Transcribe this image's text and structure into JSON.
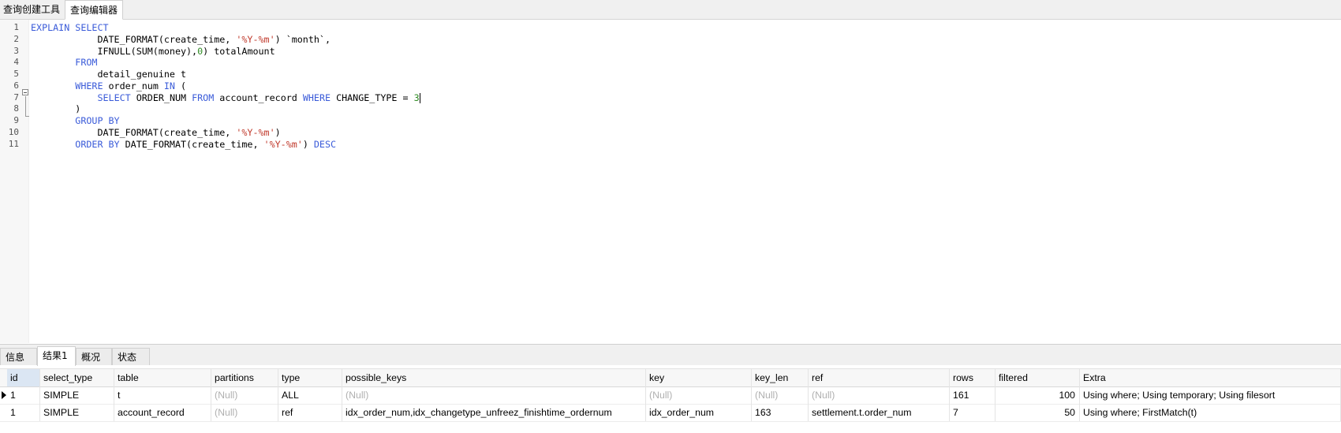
{
  "top_tabs": [
    "查询创建工具",
    "查询编辑器"
  ],
  "editor": {
    "line_numbers": [
      "1",
      "2",
      "3",
      "4",
      "5",
      "6",
      "7",
      "8",
      "9",
      "10",
      "11"
    ],
    "lines": [
      [
        [
          "kw",
          "EXPLAIN SELECT"
        ]
      ],
      [
        [
          "",
          "            DATE_FORMAT(create_time, "
        ],
        [
          "str",
          "'%Y-%m'"
        ],
        [
          "",
          ") `month`,"
        ]
      ],
      [
        [
          "",
          "            IFNULL(SUM(money),"
        ],
        [
          "num",
          "0"
        ],
        [
          "",
          ") totalAmount"
        ]
      ],
      [
        [
          "",
          "        "
        ],
        [
          "kw",
          "FROM"
        ]
      ],
      [
        [
          "",
          "            detail_genuine t"
        ]
      ],
      [
        [
          "",
          "        "
        ],
        [
          "kw",
          "WHERE"
        ],
        [
          "",
          " order_num "
        ],
        [
          "kw",
          "IN"
        ],
        [
          "",
          " ("
        ]
      ],
      [
        [
          "",
          "            "
        ],
        [
          "kw",
          "SELECT"
        ],
        [
          "",
          " ORDER_NUM "
        ],
        [
          "kw",
          "FROM"
        ],
        [
          "",
          " account_record "
        ],
        [
          "kw",
          "WHERE"
        ],
        [
          "",
          " CHANGE_TYPE = "
        ],
        [
          "num",
          "3"
        ]
      ],
      [
        [
          "",
          "        )"
        ]
      ],
      [
        [
          "",
          "        "
        ],
        [
          "kw",
          "GROUP BY"
        ]
      ],
      [
        [
          "",
          "            DATE_FORMAT(create_time, "
        ],
        [
          "str",
          "'%Y-%m'"
        ],
        [
          "",
          ")"
        ]
      ],
      [
        [
          "",
          "        "
        ],
        [
          "kw",
          "ORDER BY"
        ],
        [
          "",
          " DATE_FORMAT(create_time, "
        ],
        [
          "str",
          "'%Y-%m'"
        ],
        [
          "",
          ") "
        ],
        [
          "kw",
          "DESC"
        ]
      ]
    ]
  },
  "bottom_tabs": [
    "信息",
    "结果1",
    "概况",
    "状态"
  ],
  "result": {
    "columns": [
      "id",
      "select_type",
      "table",
      "partitions",
      "type",
      "possible_keys",
      "key",
      "key_len",
      "ref",
      "rows",
      "filtered",
      "Extra"
    ],
    "rows": [
      [
        "1",
        "SIMPLE",
        "t",
        "(Null)",
        "ALL",
        "(Null)",
        "(Null)",
        "(Null)",
        "(Null)",
        "161",
        "100",
        "Using where; Using temporary; Using filesort"
      ],
      [
        "1",
        "SIMPLE",
        "account_record",
        "(Null)",
        "ref",
        "idx_order_num,idx_changetype_unfreez_finishtime_ordernum",
        "idx_order_num",
        "163",
        "settlement.t.order_num",
        "7",
        "50",
        "Using where; FirstMatch(t)"
      ]
    ]
  },
  "colors": {
    "keyword": "#3a5bd9",
    "string": "#c0392b",
    "number": "#2e8b22",
    "null": "#b0b0b0"
  }
}
